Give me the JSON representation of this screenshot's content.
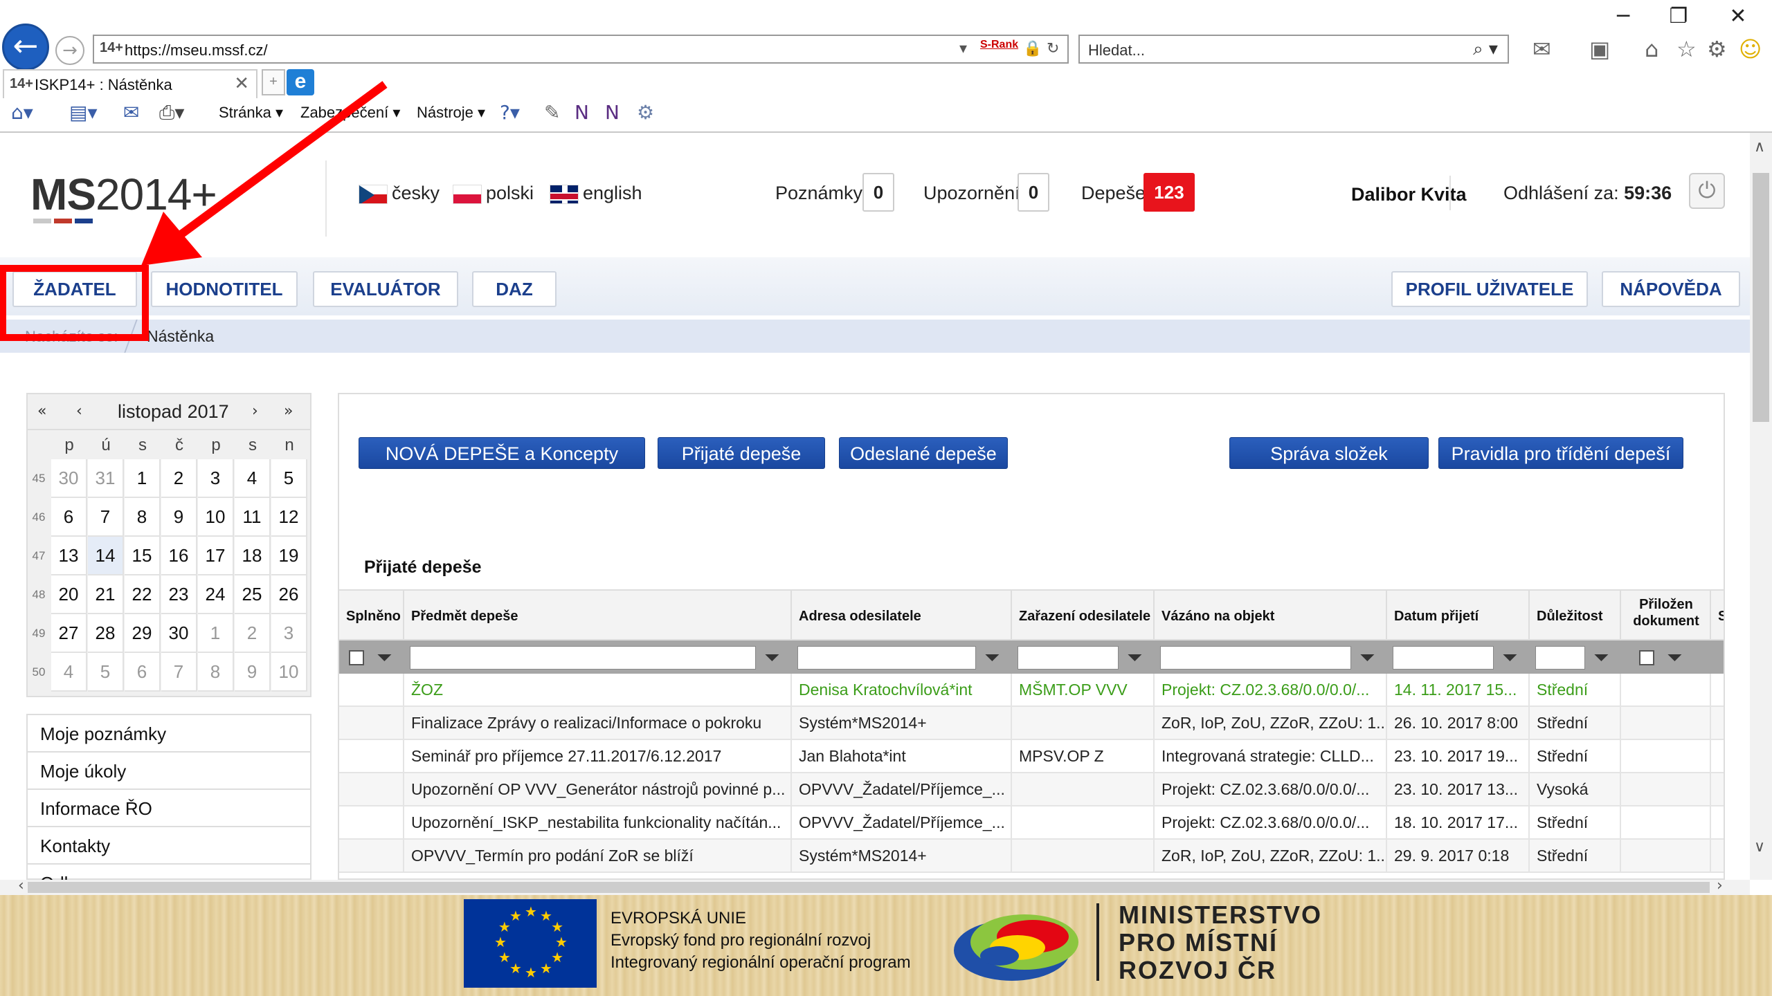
{
  "browser": {
    "url": "https://mseu.mssf.cz/",
    "srank": "S-Rank",
    "search_placeholder": "Hledat...",
    "tab_title": "ISKP14+ : Nástěnka",
    "favicon_text": "14+",
    "menu": [
      "Stránka",
      "Zabezpečení",
      "Nástroje"
    ]
  },
  "header": {
    "logo_bold": "MS",
    "logo_rest": "2014+",
    "languages": [
      {
        "label": "česky",
        "flag": "cz"
      },
      {
        "label": "polski",
        "flag": "pl"
      },
      {
        "label": "english",
        "flag": "en"
      }
    ],
    "poznamky_label": "Poznámky",
    "poznamky_count": "0",
    "upozorneni_label": "Upozornění",
    "upozorneni_count": "0",
    "depese_label": "Depeše",
    "depese_count": "123",
    "user_name": "Dalibor Kvita",
    "logout_label": "Odhlášení za:",
    "logout_time": "59:36"
  },
  "nav": {
    "zadatel": "ŽADATEL",
    "hodnotitel": "HODNOTITEL",
    "evaluator": "EVALUÁTOR",
    "daz": "DAZ",
    "profil": "PROFIL UŽIVATELE",
    "napoveda": "NÁPOVĚDA"
  },
  "breadcrumb": {
    "prefix": "Nacházíte se:",
    "current": "Nástěnka"
  },
  "calendar": {
    "month": "listopad 2017",
    "nav": [
      "«",
      "‹",
      "›",
      "»"
    ],
    "dow": [
      "p",
      "ú",
      "s",
      "č",
      "p",
      "s",
      "n"
    ],
    "weeks": [
      {
        "no": "45",
        "days": [
          "30",
          "31",
          "1",
          "2",
          "3",
          "4",
          "5"
        ],
        "other": [
          true,
          true,
          false,
          false,
          false,
          false,
          false
        ]
      },
      {
        "no": "46",
        "days": [
          "6",
          "7",
          "8",
          "9",
          "10",
          "11",
          "12"
        ],
        "other": [
          false,
          false,
          false,
          false,
          false,
          false,
          false
        ]
      },
      {
        "no": "47",
        "days": [
          "13",
          "14",
          "15",
          "16",
          "17",
          "18",
          "19"
        ],
        "other": [
          false,
          false,
          false,
          false,
          false,
          false,
          false
        ]
      },
      {
        "no": "48",
        "days": [
          "20",
          "21",
          "22",
          "23",
          "24",
          "25",
          "26"
        ],
        "other": [
          false,
          false,
          false,
          false,
          false,
          false,
          false
        ]
      },
      {
        "no": "49",
        "days": [
          "27",
          "28",
          "29",
          "30",
          "1",
          "2",
          "3"
        ],
        "other": [
          false,
          false,
          false,
          false,
          true,
          true,
          true
        ]
      },
      {
        "no": "50",
        "days": [
          "4",
          "5",
          "6",
          "7",
          "8",
          "9",
          "10"
        ],
        "other": [
          true,
          true,
          true,
          true,
          true,
          true,
          true
        ]
      }
    ],
    "today": "14"
  },
  "side_menu": [
    "Moje poznámky",
    "Moje úkoly",
    "Informace ŘO",
    "Kontakty",
    "Odkazy"
  ],
  "buttons": {
    "nova": "NOVÁ DEPEŠE a Koncepty",
    "prijate": "Přijaté depeše",
    "odeslane": "Odeslané depeše",
    "sprava": "Správa složek",
    "pravidla": "Pravidla pro třídění depeší"
  },
  "table": {
    "title": "Přijaté depeše",
    "columns": [
      "Splněno",
      "Předmět depeše",
      "Adresa odesilatele",
      "Zařazení odesilatele",
      "Vázáno na objekt",
      "Datum přijetí",
      "Důležitost",
      "Přiložen dokument",
      "S..."
    ],
    "rows": [
      [
        "",
        "ŽOZ",
        "Denisa Kratochvílová*int",
        "MŠMT.OP VVV",
        "Projekt: CZ.02.3.68/0.0/0.0/...",
        "14. 11. 2017 15...",
        "Střední",
        ""
      ],
      [
        "",
        "Finalizace Zprávy o realizaci/Informace o pokroku",
        "Systém*MS2014+",
        "",
        "ZoR, IoP, ZoU, ZZoR, ZZoU: 1...",
        "26. 10. 2017 8:00",
        "Střední",
        ""
      ],
      [
        "",
        "Seminář pro příjemce 27.11.2017/6.12.2017",
        "Jan Blahota*int",
        "MPSV.OP Z",
        "Integrovaná strategie: CLLD...",
        "23. 10. 2017 19...",
        "Střední",
        ""
      ],
      [
        "",
        "Upozornění OP VVV_Generátor nástrojů povinné p...",
        "OPVVV_Žadatel/Příjemce_...",
        "",
        "Projekt: CZ.02.3.68/0.0/0.0/...",
        "23. 10. 2017 13...",
        "Vysoká",
        ""
      ],
      [
        "",
        "Upozornění_ISKP_nestabilita funkcionality načítán...",
        "OPVVV_Žadatel/Příjemce_...",
        "",
        "Projekt: CZ.02.3.68/0.0/0.0/...",
        "18. 10. 2017 17...",
        "Střední",
        ""
      ],
      [
        "",
        "OPVVV_Termín pro podání ZoR se blíží",
        "Systém*MS2014+",
        "",
        "ZoR, IoP, ZoU, ZZoR, ZZoU: 1...",
        "29. 9. 2017 0:18",
        "Střední",
        ""
      ]
    ]
  },
  "footer": {
    "eu_line1": "EVROPSKÁ UNIE",
    "eu_line2": "Evropský fond pro regionální rozvoj",
    "eu_line3": "Integrovaný regionální operační program",
    "mmr_line1": "MINISTERSTVO",
    "mmr_line2": "PRO MÍSTNÍ",
    "mmr_line3": "ROZVOJ ČR"
  },
  "colors": {
    "nav_text": "#1b3f8c",
    "button_blue": "#1a48a0",
    "badge_red": "#e8141c",
    "row_green": "#3b9d19",
    "annotation_red": "#ff0000"
  }
}
